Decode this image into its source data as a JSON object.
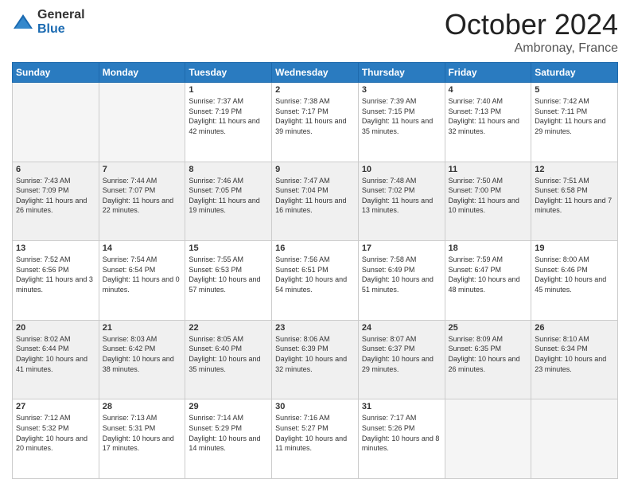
{
  "logo": {
    "general": "General",
    "blue": "Blue"
  },
  "header": {
    "month": "October 2024",
    "location": "Ambronay, France"
  },
  "days_of_week": [
    "Sunday",
    "Monday",
    "Tuesday",
    "Wednesday",
    "Thursday",
    "Friday",
    "Saturday"
  ],
  "weeks": [
    [
      {
        "day": null
      },
      {
        "day": null
      },
      {
        "day": "1",
        "sunrise": "7:37 AM",
        "sunset": "7:19 PM",
        "daylight": "11 hours and 42 minutes."
      },
      {
        "day": "2",
        "sunrise": "7:38 AM",
        "sunset": "7:17 PM",
        "daylight": "11 hours and 39 minutes."
      },
      {
        "day": "3",
        "sunrise": "7:39 AM",
        "sunset": "7:15 PM",
        "daylight": "11 hours and 35 minutes."
      },
      {
        "day": "4",
        "sunrise": "7:40 AM",
        "sunset": "7:13 PM",
        "daylight": "11 hours and 32 minutes."
      },
      {
        "day": "5",
        "sunrise": "7:42 AM",
        "sunset": "7:11 PM",
        "daylight": "11 hours and 29 minutes."
      }
    ],
    [
      {
        "day": "6",
        "sunrise": "7:43 AM",
        "sunset": "7:09 PM",
        "daylight": "11 hours and 26 minutes."
      },
      {
        "day": "7",
        "sunrise": "7:44 AM",
        "sunset": "7:07 PM",
        "daylight": "11 hours and 22 minutes."
      },
      {
        "day": "8",
        "sunrise": "7:46 AM",
        "sunset": "7:05 PM",
        "daylight": "11 hours and 19 minutes."
      },
      {
        "day": "9",
        "sunrise": "7:47 AM",
        "sunset": "7:04 PM",
        "daylight": "11 hours and 16 minutes."
      },
      {
        "day": "10",
        "sunrise": "7:48 AM",
        "sunset": "7:02 PM",
        "daylight": "11 hours and 13 minutes."
      },
      {
        "day": "11",
        "sunrise": "7:50 AM",
        "sunset": "7:00 PM",
        "daylight": "11 hours and 10 minutes."
      },
      {
        "day": "12",
        "sunrise": "7:51 AM",
        "sunset": "6:58 PM",
        "daylight": "11 hours and 7 minutes."
      }
    ],
    [
      {
        "day": "13",
        "sunrise": "7:52 AM",
        "sunset": "6:56 PM",
        "daylight": "11 hours and 3 minutes."
      },
      {
        "day": "14",
        "sunrise": "7:54 AM",
        "sunset": "6:54 PM",
        "daylight": "11 hours and 0 minutes."
      },
      {
        "day": "15",
        "sunrise": "7:55 AM",
        "sunset": "6:53 PM",
        "daylight": "10 hours and 57 minutes."
      },
      {
        "day": "16",
        "sunrise": "7:56 AM",
        "sunset": "6:51 PM",
        "daylight": "10 hours and 54 minutes."
      },
      {
        "day": "17",
        "sunrise": "7:58 AM",
        "sunset": "6:49 PM",
        "daylight": "10 hours and 51 minutes."
      },
      {
        "day": "18",
        "sunrise": "7:59 AM",
        "sunset": "6:47 PM",
        "daylight": "10 hours and 48 minutes."
      },
      {
        "day": "19",
        "sunrise": "8:00 AM",
        "sunset": "6:46 PM",
        "daylight": "10 hours and 45 minutes."
      }
    ],
    [
      {
        "day": "20",
        "sunrise": "8:02 AM",
        "sunset": "6:44 PM",
        "daylight": "10 hours and 41 minutes."
      },
      {
        "day": "21",
        "sunrise": "8:03 AM",
        "sunset": "6:42 PM",
        "daylight": "10 hours and 38 minutes."
      },
      {
        "day": "22",
        "sunrise": "8:05 AM",
        "sunset": "6:40 PM",
        "daylight": "10 hours and 35 minutes."
      },
      {
        "day": "23",
        "sunrise": "8:06 AM",
        "sunset": "6:39 PM",
        "daylight": "10 hours and 32 minutes."
      },
      {
        "day": "24",
        "sunrise": "8:07 AM",
        "sunset": "6:37 PM",
        "daylight": "10 hours and 29 minutes."
      },
      {
        "day": "25",
        "sunrise": "8:09 AM",
        "sunset": "6:35 PM",
        "daylight": "10 hours and 26 minutes."
      },
      {
        "day": "26",
        "sunrise": "8:10 AM",
        "sunset": "6:34 PM",
        "daylight": "10 hours and 23 minutes."
      }
    ],
    [
      {
        "day": "27",
        "sunrise": "7:12 AM",
        "sunset": "5:32 PM",
        "daylight": "10 hours and 20 minutes."
      },
      {
        "day": "28",
        "sunrise": "7:13 AM",
        "sunset": "5:31 PM",
        "daylight": "10 hours and 17 minutes."
      },
      {
        "day": "29",
        "sunrise": "7:14 AM",
        "sunset": "5:29 PM",
        "daylight": "10 hours and 14 minutes."
      },
      {
        "day": "30",
        "sunrise": "7:16 AM",
        "sunset": "5:27 PM",
        "daylight": "10 hours and 11 minutes."
      },
      {
        "day": "31",
        "sunrise": "7:17 AM",
        "sunset": "5:26 PM",
        "daylight": "10 hours and 8 minutes."
      },
      {
        "day": null
      },
      {
        "day": null
      }
    ]
  ],
  "labels": {
    "sunrise": "Sunrise:",
    "sunset": "Sunset:",
    "daylight": "Daylight:"
  }
}
